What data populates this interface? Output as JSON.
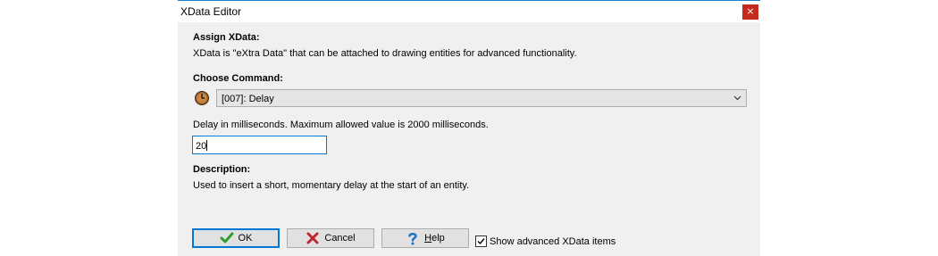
{
  "window": {
    "title": "XData Editor",
    "close_glyph": "×"
  },
  "assign": {
    "heading": "Assign XData:",
    "text": "XData is \"eXtra Data\" that can be attached to drawing entities for advanced functionality."
  },
  "command": {
    "heading": "Choose Command:",
    "selected": "[007]: Delay",
    "icon": "timer-icon"
  },
  "param": {
    "label": "Delay in milliseconds. Maximum allowed value is 2000 milliseconds.",
    "value": "20"
  },
  "description": {
    "heading": "Description:",
    "text": "Used to insert a short, momentary delay at the start of an entity."
  },
  "buttons": {
    "ok": "OK",
    "cancel": "Cancel",
    "help_prefix": "",
    "help_underlined": "H",
    "help_rest": "elp"
  },
  "show_advanced": {
    "label": "Show advanced XData items",
    "checked": true
  },
  "colors": {
    "accent": "#0078d7",
    "close": "#c42b1c",
    "ok_green": "#2e9e2e",
    "cancel_red": "#c0282d",
    "help_blue": "#1e73be"
  }
}
